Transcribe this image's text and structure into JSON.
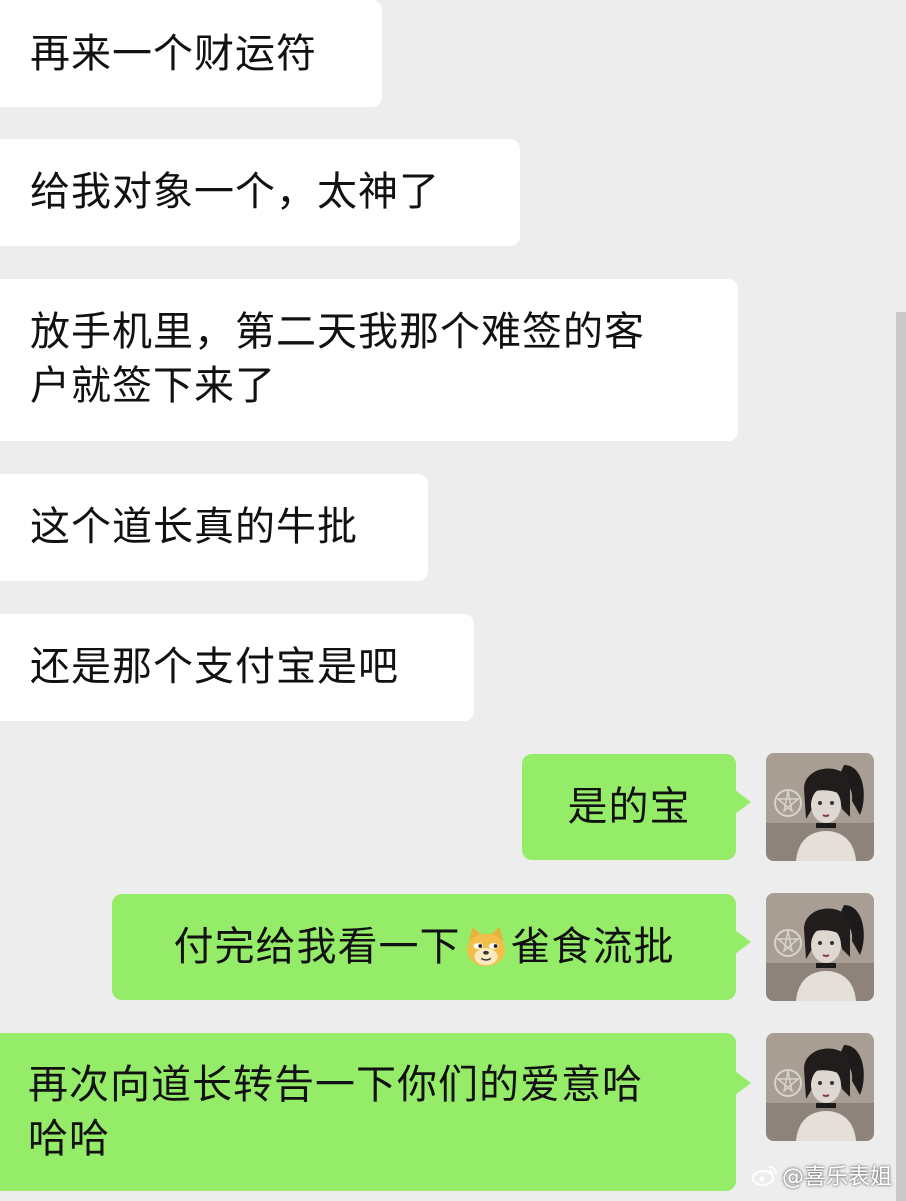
{
  "messages": [
    {
      "side": "in",
      "text": "再来一个财运符"
    },
    {
      "side": "in",
      "text": "给我对象一个，太神了"
    },
    {
      "side": "in",
      "line1": "放手机里，第二天我那个难签的客",
      "line2": "户就签下来了"
    },
    {
      "side": "in",
      "text": "这个道长真的牛批"
    },
    {
      "side": "in",
      "text": "还是那个支付宝是吧"
    },
    {
      "side": "out",
      "text": "是的宝"
    },
    {
      "side": "out",
      "text_before": "付完给我看一下",
      "emoji": "doge-emoji",
      "text_after": "雀食流批"
    },
    {
      "side": "out",
      "line1": "再次向道长转告一下你们的爱意哈",
      "line2": "哈哈"
    }
  ],
  "watermark": {
    "text": "@喜乐表姐",
    "icon": "weibo-icon"
  },
  "colors": {
    "background": "#ededed",
    "incoming_bubble": "#ffffff",
    "outgoing_bubble": "#95ec69",
    "text": "#111111"
  }
}
